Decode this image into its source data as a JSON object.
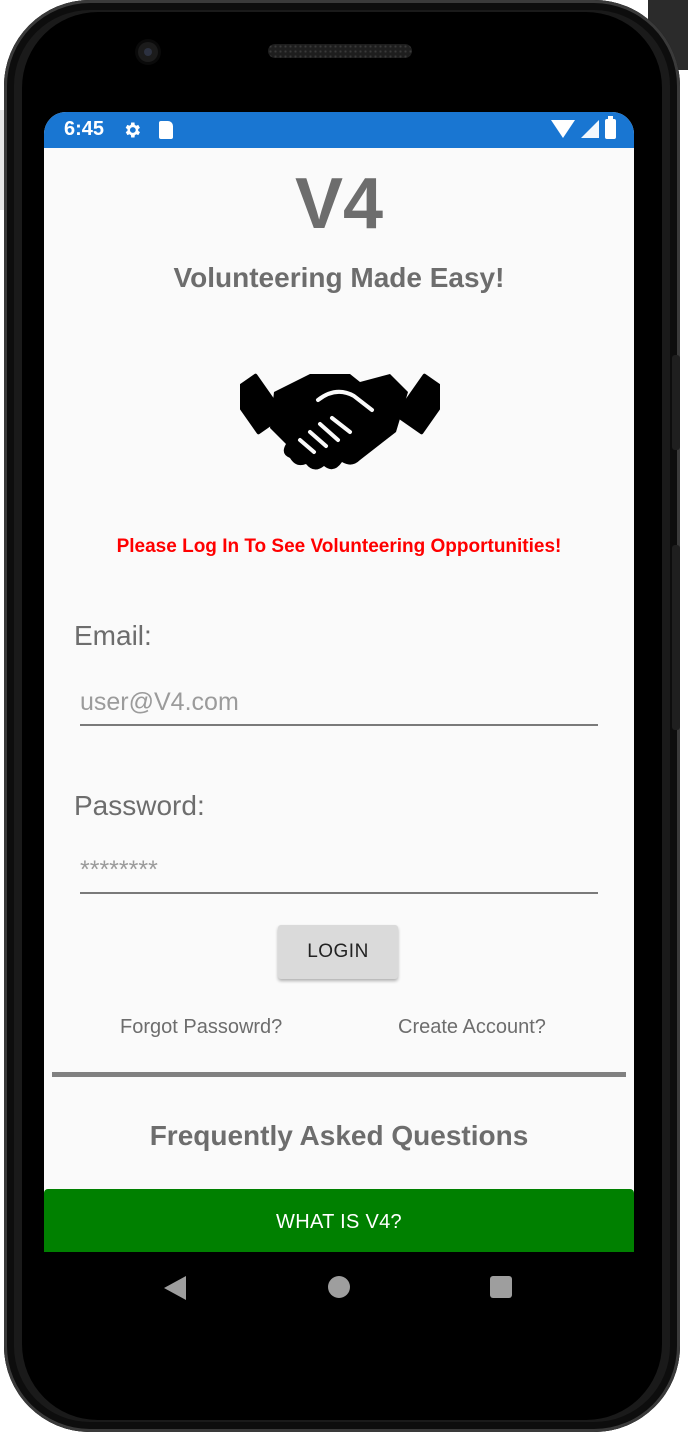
{
  "status_bar": {
    "time": "6:45",
    "icons": [
      "settings-gear-icon",
      "sd-card-icon",
      "wifi-icon",
      "cell-signal-icon",
      "battery-icon"
    ],
    "color": "#1976d2"
  },
  "app": {
    "title": "V4",
    "tagline": "Volunteering Made Easy!",
    "logo_icon": "handshake-icon",
    "notice": "Please Log In To See Volunteering Opportunities!",
    "notice_color": "#ff0000"
  },
  "login": {
    "email_label": "Email:",
    "email_placeholder": "user@V4.com",
    "password_label": "Password:",
    "password_placeholder": "********",
    "login_button": "LOGIN",
    "forgot_link": "Forgot Passowrd?",
    "create_link": "Create Account?"
  },
  "faq": {
    "title": "Frequently Asked Questions",
    "first_question": "WHAT IS V4?",
    "button_color": "#008000"
  },
  "nav": {
    "icons": [
      "back-icon",
      "home-icon",
      "recents-icon"
    ]
  }
}
